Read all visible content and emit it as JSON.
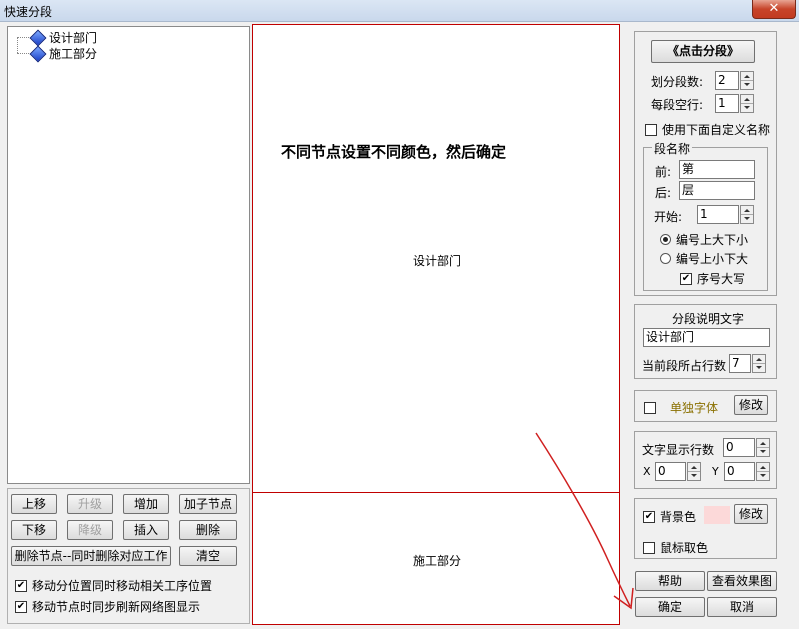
{
  "window": {
    "title": "快速分段",
    "close_glyph": "✕"
  },
  "tree": {
    "nodes": [
      {
        "label": "设计部门"
      },
      {
        "label": "施工部分"
      }
    ]
  },
  "left_buttons": {
    "move_up": "上移",
    "promote": "升级",
    "add": "增加",
    "add_child": "加子节点",
    "move_down": "下移",
    "demote": "降级",
    "insert": "插入",
    "delete": "删除",
    "delete_node_work": "删除节点--同时删除对应工作",
    "clear": "清空"
  },
  "left_checks": {
    "move_related": {
      "label": "移动分位置同时移动相关工序位置",
      "checked": true
    },
    "sync_refresh": {
      "label": "移动节点时同步刷新网络图显示",
      "checked": true
    }
  },
  "canvas": {
    "note": "不同节点设置不同颜色，然后确定",
    "segments": [
      "设计部门",
      "施工部分"
    ]
  },
  "right": {
    "click_segment": "《点击分段》",
    "segment_count_label": "划分段数:",
    "segment_count": "2",
    "blank_rows_label": "每段空行:",
    "blank_rows": "1",
    "use_custom_name": {
      "label": "使用下面自定义名称",
      "checked": false
    },
    "name_group": {
      "legend": "段名称",
      "prefix_label": "前:",
      "prefix": "第",
      "suffix_label": "后:",
      "suffix": "层",
      "start_label": "开始:",
      "start": "1",
      "order_top_large": {
        "label": "编号上大下小",
        "selected": true
      },
      "order_top_small": {
        "label": "编号上小下大",
        "selected": false
      },
      "uppercase": {
        "label": "序号大写",
        "checked": true
      }
    },
    "desc_group": {
      "legend": "分段说明文字",
      "text": "设计部门",
      "rows_label": "当前段所占行数",
      "rows": "7"
    },
    "font_group": {
      "single_font": {
        "label": "单独字体",
        "checked": false
      },
      "modify": "修改"
    },
    "text_group": {
      "rows_label": "文字显示行数",
      "rows": "0",
      "x_label": "X",
      "x": "0",
      "y_label": "Y",
      "y": "0"
    },
    "bg_group": {
      "bg_color": {
        "label": "背景色",
        "checked": true
      },
      "bg_swatch_color": "#fcd9d9",
      "modify": "修改",
      "mouse_pick": {
        "label": "鼠标取色",
        "checked": false
      }
    },
    "help": "帮助",
    "preview": "查看效果图",
    "ok": "确定",
    "cancel": "取消"
  },
  "colors": {
    "canvas_border": "#c00000",
    "single_font_text": "#8a7000",
    "annotation_arrow": "#d02020"
  }
}
